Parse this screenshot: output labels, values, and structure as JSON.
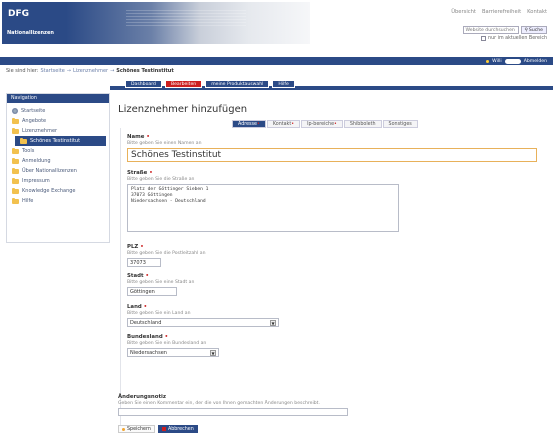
{
  "header": {
    "logo_text": "DFG",
    "logo_sub": "Nationallizenzen",
    "nav": [
      "Übersicht",
      "Barrierefreiheit",
      "Kontakt"
    ],
    "search_placeholder": "Website durchsuchen",
    "search_button": "Suche",
    "search_scope_label": "nur im aktuellen Bereich"
  },
  "userbar": {
    "user_label": "Willi",
    "logout": "Abmelden"
  },
  "breadcrumb": {
    "prefix": "Sie sind hier:",
    "items": [
      "Startseite",
      "Lizenznehmer",
      "Schönes Testinstitut"
    ],
    "separator": "→"
  },
  "tabs": [
    "Dashboard",
    "Bearbeiten",
    "meine Produktauswahl",
    "Hilfe"
  ],
  "sidebar": {
    "title": "Navigation",
    "items": [
      {
        "label": "Startseite"
      },
      {
        "label": "Angebote"
      },
      {
        "label": "Lizenznehmer"
      },
      {
        "label": "Schönes Testinstitut"
      },
      {
        "label": "Tools"
      },
      {
        "label": "Anmeldung"
      },
      {
        "label": "Über Nationallizenzen"
      },
      {
        "label": "Impressum"
      },
      {
        "label": "Knowledge Exchange"
      },
      {
        "label": "Hilfe"
      }
    ]
  },
  "main": {
    "title": "Lizenznehmer hinzufügen",
    "form_tabs": [
      {
        "label": "Adresse",
        "required": true
      },
      {
        "label": "Kontakt",
        "required": true
      },
      {
        "label": "Ip-bereiche",
        "required": true
      },
      {
        "label": "Shibboleth",
        "required": false
      },
      {
        "label": "Sonstiges",
        "required": false
      }
    ],
    "required_mark": "•",
    "fields": {
      "name": {
        "label": "Name",
        "hint": "Bitte geben Sie einen Namen an",
        "value": "Schönes Testinstitut"
      },
      "strasse": {
        "label": "Straße",
        "hint": "Bitte geben Sie die Straße an",
        "value": "Platz der Göttinger Sieben 1\n37073 Göttingen\nNiedersachsen - Deutschland"
      },
      "plz": {
        "label": "PLZ",
        "hint": "Bitte geben Sie die Postleitzahl an",
        "value": "37073"
      },
      "stadt": {
        "label": "Stadt",
        "hint": "Bitte geben Sie eine Stadt an",
        "value": "Göttingen"
      },
      "land": {
        "label": "Land",
        "hint": "Bitte geben Sie ein Land an",
        "value": "Deutschland"
      },
      "bundesland": {
        "label": "Bundesland",
        "hint": "Bitte geben Sie ein Bundesland an",
        "value": "Niedersachsen"
      },
      "notiz": {
        "label": "Änderungsnotiz",
        "hint": "Geben Sie einen Kommentar ein, der die von Ihnen gemachten Änderungen beschreibt.",
        "value": ""
      }
    },
    "save_label": "Speichern",
    "cancel_label": "Abbrechen"
  },
  "colors": {
    "brand_blue": "#2b4a86",
    "active_red": "#cc1f1f",
    "folder_yellow": "#f2c14e"
  }
}
